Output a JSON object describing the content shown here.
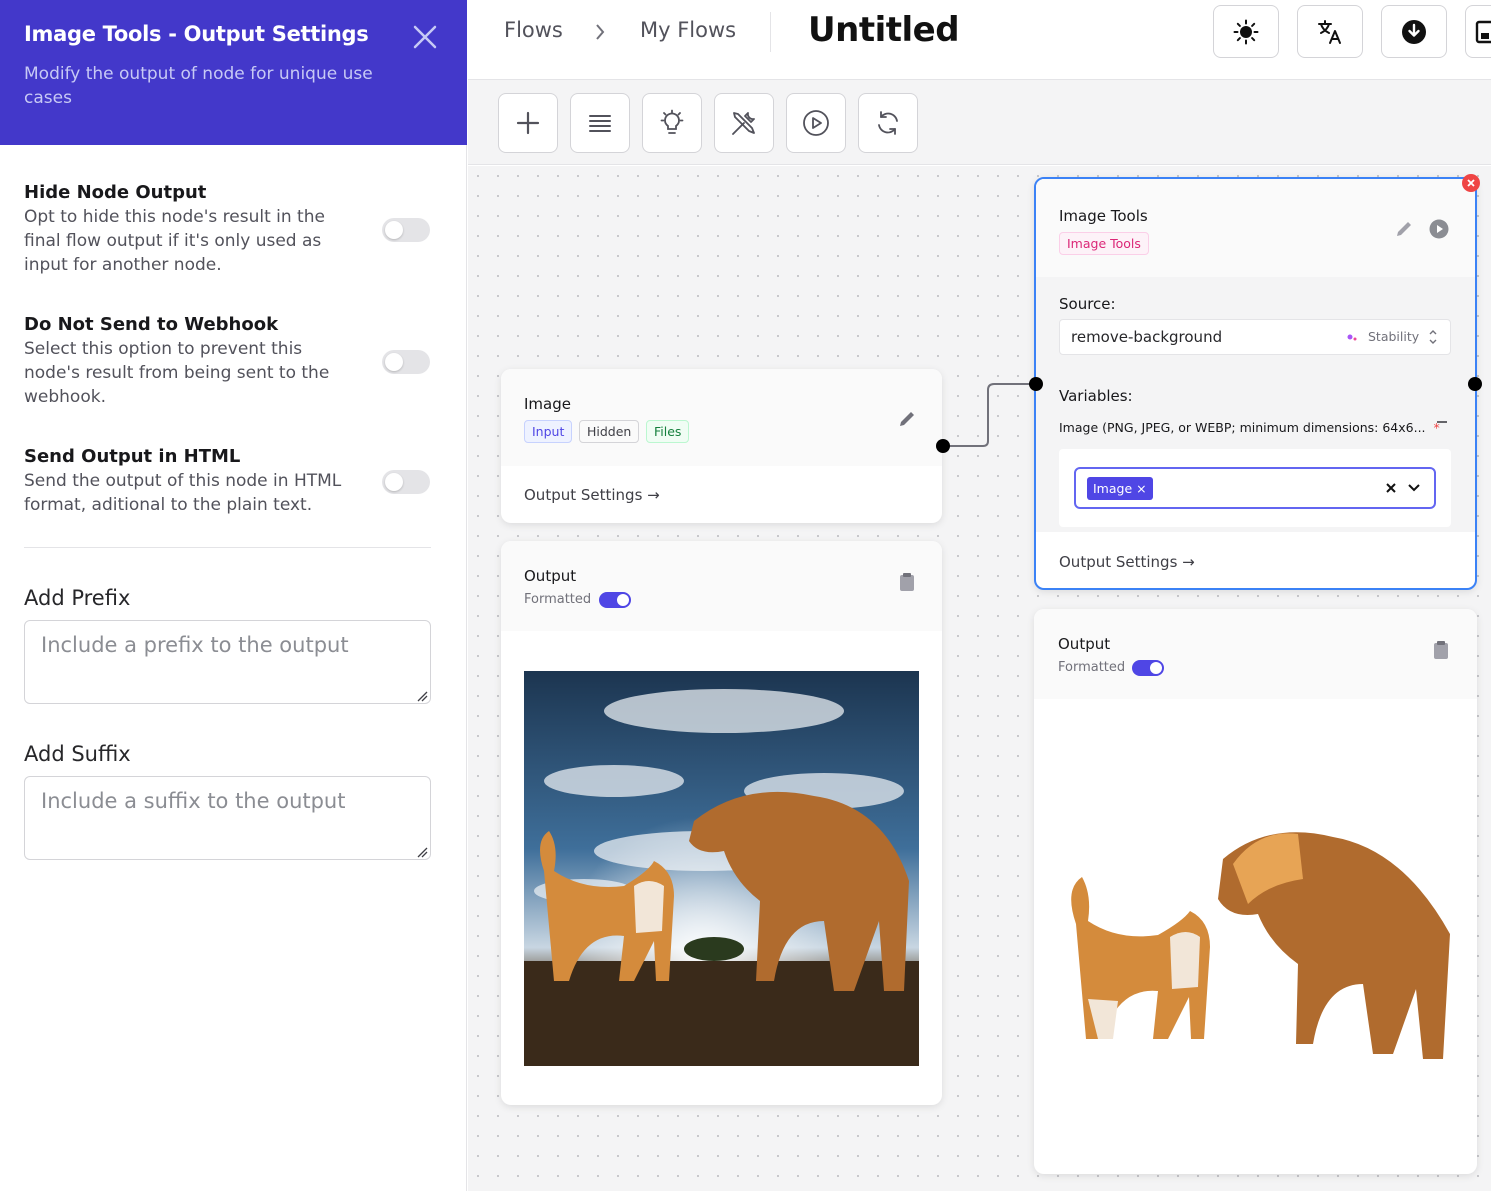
{
  "panel": {
    "title": "Image Tools - Output Settings",
    "subtitle": "Modify the output of node for unique use cases",
    "options": [
      {
        "title": "Hide Node Output",
        "description": "Opt to hide this node's result in the final flow output if it's only used as input for another node.",
        "enabled": false
      },
      {
        "title": "Do Not Send to Webhook",
        "description": "Select this option to prevent this node's result from being sent to the webhook.",
        "enabled": false
      },
      {
        "title": "Send Output in HTML",
        "description": "Send the output of this node in HTML format, aditional to the plain text.",
        "enabled": false
      }
    ],
    "prefix": {
      "label": "Add Prefix",
      "placeholder": "Include a prefix to the output",
      "value": ""
    },
    "suffix": {
      "label": "Add Suffix",
      "placeholder": "Include a suffix to the output",
      "value": ""
    }
  },
  "topbar": {
    "breadcrumbs": [
      "Flows",
      "My Flows"
    ],
    "title": "Untitled",
    "buttons": [
      "theme-icon",
      "translate-icon",
      "download-icon",
      "save-icon"
    ]
  },
  "toolbar": {
    "buttons": [
      "add-icon",
      "menu-icon",
      "lightbulb-icon",
      "tools-icon",
      "play-icon",
      "refresh-icon"
    ]
  },
  "nodes": {
    "image_input": {
      "name": "Image",
      "tags": [
        "Input",
        "Hidden",
        "Files"
      ],
      "output_settings": "Output Settings →"
    },
    "image_tools": {
      "name": "Image Tools",
      "tag": "Image Tools",
      "source_label": "Source:",
      "source_value": "remove-background",
      "source_provider": "Stability",
      "variables_label": "Variables:",
      "variable_name": "Image (PNG, JPEG, or WEBP; minimum dimensions: 64x6...",
      "required_mark": "*",
      "selected_chip": "Image",
      "output_settings": "Output Settings →"
    },
    "output_left": {
      "name": "Output",
      "formatted_label": "Formatted",
      "formatted": true,
      "image": "photo of a cat and a lion facing each other under a dramatic cloudy sky"
    },
    "output_right": {
      "name": "Output",
      "formatted_label": "Formatted",
      "formatted": true,
      "image": "same cat and lion with the background removed"
    }
  },
  "colors": {
    "brand": "#4338ca",
    "accent": "#4f46e5",
    "selected_border": "#3b82f6",
    "delete": "#ef4444"
  }
}
